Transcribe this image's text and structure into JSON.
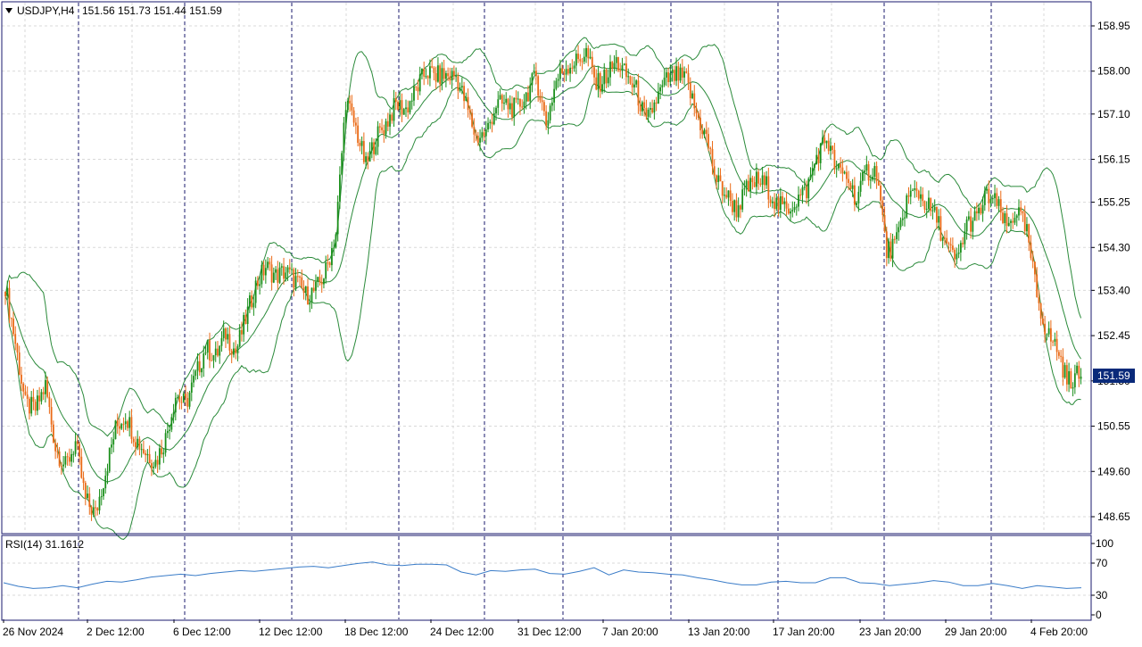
{
  "header": {
    "symbol": "USDJPY,H4",
    "ohlc": "151.56 151.73 151.44 151.59"
  },
  "price_tag": "151.59",
  "rsi_header": "RSI(14) 31.1612",
  "colors": {
    "bull": "#1a8f1a",
    "bear": "#ea6a16",
    "bands": "#2a8a3a",
    "rsi": "#3a7cc8",
    "grid": "#d9d9d9",
    "separator": "#1a1a6e",
    "frame": "#1a1a6e",
    "tag_bg": "#0a2a7a"
  },
  "chart_data": [
    {
      "type": "candlestick",
      "title": "USDJPY,H4",
      "indicator": "Bollinger Bands",
      "ylim": [
        148.2,
        159.4
      ],
      "y_ticks": [
        "158.95",
        "158.00",
        "157.10",
        "156.15",
        "155.25",
        "154.30",
        "153.40",
        "152.45",
        "151.50",
        "150.55",
        "149.60",
        "148.65"
      ],
      "x_ticks": [
        "26 Nov 2024",
        "2 Dec 12:00",
        "6 Dec 12:00",
        "12 Dec 12:00",
        "18 Dec 12:00",
        "24 Dec 12:00",
        "31 Dec 12:00",
        "7 Jan 20:00",
        "13 Jan 20:00",
        "17 Jan 20:00",
        "23 Jan 20:00",
        "29 Jan 20:00",
        "4 Feb 20:00"
      ],
      "grid": true,
      "anchors": [
        [
          0,
          153.5
        ],
        [
          5,
          152.3
        ],
        [
          10,
          151.0
        ],
        [
          15,
          150.9
        ],
        [
          20,
          151.4
        ],
        [
          25,
          150.1
        ],
        [
          30,
          149.7
        ],
        [
          35,
          150.2
        ],
        [
          40,
          149.0
        ],
        [
          45,
          148.7
        ],
        [
          50,
          149.6
        ],
        [
          55,
          150.5
        ],
        [
          60,
          150.8
        ],
        [
          65,
          150.3
        ],
        [
          70,
          150.0
        ],
        [
          75,
          149.8
        ],
        [
          80,
          150.3
        ],
        [
          85,
          151.2
        ],
        [
          90,
          151.0
        ],
        [
          95,
          151.6
        ],
        [
          100,
          152.2
        ],
        [
          105,
          152.0
        ],
        [
          110,
          152.5
        ],
        [
          115,
          152.1
        ],
        [
          120,
          152.8
        ],
        [
          125,
          153.5
        ],
        [
          130,
          153.9
        ],
        [
          135,
          153.7
        ],
        [
          140,
          153.8
        ],
        [
          145,
          153.6
        ],
        [
          150,
          153.3
        ],
        [
          155,
          153.4
        ],
        [
          160,
          153.8
        ],
        [
          165,
          154.6
        ],
        [
          170,
          157.4
        ],
        [
          175,
          156.8
        ],
        [
          180,
          156.0
        ],
        [
          185,
          156.6
        ],
        [
          190,
          156.9
        ],
        [
          195,
          157.3
        ],
        [
          200,
          157.2
        ],
        [
          205,
          157.6
        ],
        [
          210,
          158.0
        ],
        [
          215,
          157.9
        ],
        [
          220,
          157.9
        ],
        [
          225,
          157.9
        ],
        [
          230,
          157.3
        ],
        [
          235,
          156.6
        ],
        [
          240,
          156.7
        ],
        [
          245,
          157.3
        ],
        [
          250,
          157.3
        ],
        [
          255,
          157.2
        ],
        [
          260,
          157.5
        ],
        [
          265,
          157.9
        ],
        [
          270,
          156.9
        ],
        [
          275,
          157.8
        ],
        [
          280,
          158.1
        ],
        [
          285,
          158.2
        ],
        [
          290,
          158.4
        ],
        [
          295,
          157.7
        ],
        [
          300,
          157.9
        ],
        [
          305,
          158.2
        ],
        [
          310,
          157.9
        ],
        [
          315,
          157.6
        ],
        [
          320,
          156.9
        ],
        [
          325,
          157.4
        ],
        [
          330,
          157.8
        ],
        [
          335,
          157.9
        ],
        [
          340,
          157.8
        ],
        [
          345,
          157.1
        ],
        [
          350,
          156.6
        ],
        [
          355,
          155.7
        ],
        [
          360,
          155.4
        ],
        [
          365,
          155.1
        ],
        [
          370,
          155.5
        ],
        [
          375,
          155.7
        ],
        [
          380,
          155.6
        ],
        [
          385,
          155.2
        ],
        [
          390,
          155.1
        ],
        [
          395,
          155.3
        ],
        [
          400,
          155.5
        ],
        [
          405,
          156.2
        ],
        [
          410,
          156.6
        ],
        [
          415,
          155.9
        ],
        [
          420,
          155.8
        ],
        [
          425,
          155.3
        ],
        [
          430,
          155.9
        ],
        [
          435,
          155.9
        ],
        [
          440,
          154.2
        ],
        [
          445,
          154.4
        ],
        [
          450,
          155.3
        ],
        [
          455,
          155.5
        ],
        [
          460,
          155.2
        ],
        [
          465,
          154.9
        ],
        [
          470,
          154.3
        ],
        [
          475,
          154.0
        ],
        [
          480,
          154.8
        ],
        [
          485,
          154.9
        ],
        [
          490,
          155.4
        ],
        [
          495,
          155.2
        ],
        [
          500,
          154.7
        ],
        [
          505,
          155.1
        ],
        [
          510,
          154.6
        ],
        [
          515,
          153.3
        ],
        [
          520,
          152.5
        ],
        [
          525,
          152.2
        ],
        [
          530,
          151.5
        ],
        [
          535,
          151.6
        ],
        [
          537,
          151.59
        ]
      ],
      "last_price": 151.59
    },
    {
      "type": "line",
      "title": "RSI(14)",
      "ylim": [
        0,
        100
      ],
      "y_ticks": [
        "100",
        "70",
        "30",
        "0"
      ],
      "last_value": 31.1612,
      "values": [
        45,
        40,
        37,
        38,
        41,
        38,
        43,
        47,
        46,
        49,
        53,
        55,
        57,
        55,
        58,
        60,
        62,
        61,
        63,
        65,
        67,
        68,
        66,
        69,
        72,
        74,
        70,
        69,
        71,
        71,
        70,
        60,
        56,
        62,
        61,
        63,
        64,
        58,
        57,
        61,
        66,
        56,
        63,
        60,
        59,
        57,
        56,
        52,
        49,
        45,
        42,
        42,
        46,
        47,
        45,
        45,
        52,
        52,
        45,
        44,
        41,
        43,
        45,
        48,
        46,
        41,
        41,
        44,
        41,
        37,
        41,
        39,
        37,
        38
      ]
    }
  ]
}
